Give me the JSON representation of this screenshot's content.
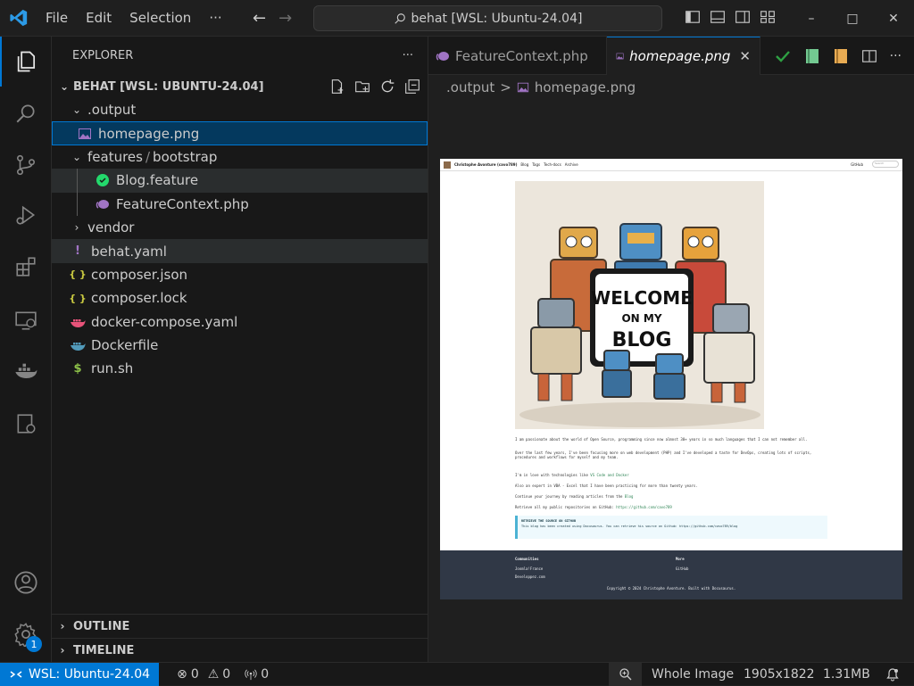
{
  "titlebar": {
    "menu": [
      "File",
      "Edit",
      "Selection"
    ],
    "more": "···",
    "search_text": "behat [WSL: Ubuntu-24.04]",
    "back": "←",
    "forward": "→",
    "minimize": "–",
    "maximize": "□",
    "close": "✕"
  },
  "sidebar": {
    "title": "EXPLORER",
    "more": "···",
    "root": "BEHAT [WSL: UBUNTU-24.04]",
    "items": [
      {
        "label": ".output",
        "type": "folder-open"
      },
      {
        "label": "homepage.png",
        "type": "image"
      },
      {
        "label": "features",
        "sep": "/",
        "label2": "bootstrap",
        "type": "folder-open"
      },
      {
        "label": "Blog.feature",
        "type": "feature"
      },
      {
        "label": "FeatureContext.php",
        "type": "php"
      },
      {
        "label": "vendor",
        "type": "folder-closed"
      },
      {
        "label": "behat.yaml",
        "type": "yaml",
        "icon_text": "!"
      },
      {
        "label": "composer.json",
        "type": "json",
        "icon_text": "{ }"
      },
      {
        "label": "composer.lock",
        "type": "json",
        "icon_text": "{ }"
      },
      {
        "label": "docker-compose.yaml",
        "type": "docker"
      },
      {
        "label": "Dockerfile",
        "type": "docker"
      },
      {
        "label": "run.sh",
        "type": "shell",
        "icon_text": "$"
      }
    ],
    "outline": "OUTLINE",
    "timeline": "TIMELINE"
  },
  "activity": {
    "settings_badge": "1"
  },
  "editor": {
    "tabs": [
      {
        "label": "FeatureContext.php",
        "active": false
      },
      {
        "label": "homepage.png",
        "active": true
      }
    ],
    "breadcrumb": [
      ".output",
      "homepage.png"
    ],
    "breadcrumb_sep": ">"
  },
  "preview": {
    "nav_title": "Christophe Avonture (cavo789)",
    "nav_links": [
      "Blog",
      "Tags",
      "Tech-docs",
      "Archive"
    ],
    "nav_right": "GitHub",
    "search": "Search",
    "hero_line1": "WELCOME",
    "hero_line2": "ON MY",
    "hero_line3": "BLOG",
    "p1": "I am passionate about the world of Open Source, programming since now almost 30+ years in so much languages that I can not remember all.",
    "p2": "Over the last few years, I've been focusing more on web development (PHP) and I've developed a taste for DevOps, creating lots of scripts, procedures and workflows for myself and my team.",
    "p3_pre": "I'm in love with technologies like ",
    "p3_link": "VS Code and Docker",
    "p4": "Also an expert in VBA - Excel that I have been practicing for more than twenty years.",
    "p5_pre": "Continue your journey by reading articles from the ",
    "p5_link": "Blog",
    "p6_pre": "Retrieve all my public repositories on GitHub: ",
    "p6_link": "https://github.com/cavo789",
    "tip_title": "RETRIEVE THE SOURCE ON GITHUB",
    "tip_text": "This blog has been created using Docusaurus. You can retrieve his source on Github: https://github.com/cavo789/blog",
    "footer_col1_title": "Communities",
    "footer_col1_items": [
      "Joomla!France",
      "Developpez.com"
    ],
    "footer_col2_title": "More",
    "footer_col2_items": [
      "GitHub"
    ],
    "footer_copy": "Copyright © 2024 Christophe Avonture. Built with Docusaurus."
  },
  "statusbar": {
    "remote": "WSL: Ubuntu-24.04",
    "errors": "0",
    "warnings": "0",
    "ports": "0",
    "zoom": "Whole Image",
    "dimensions": "1905x1822",
    "size": "1.31MB"
  },
  "colors": {
    "accent": "#0078d4",
    "selection": "#04395e",
    "check": "#2ea043",
    "book_green": "#73c991",
    "book_orange": "#e8ab53"
  }
}
